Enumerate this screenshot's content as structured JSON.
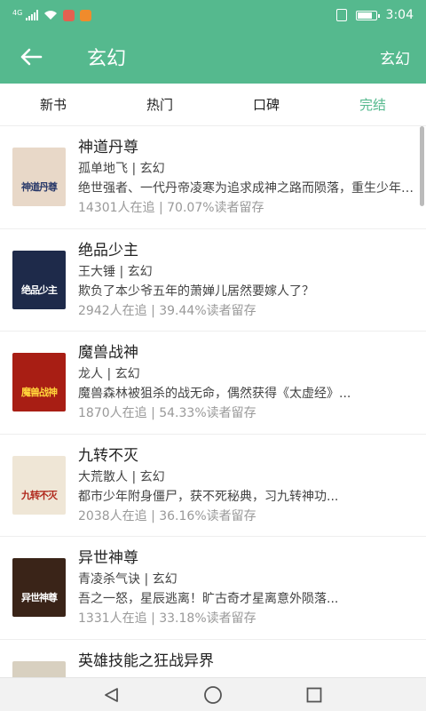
{
  "status": {
    "network": "4G",
    "time": "3:04",
    "colors": {
      "bar": "#55b98e",
      "app_icon_1": "#e36150",
      "app_icon_2": "#f08b2c"
    },
    "icons": [
      "signal-icon",
      "wifi-icon",
      "notification-app-icon",
      "video-app-icon",
      "vibrate-icon",
      "battery-icon"
    ]
  },
  "header": {
    "title": "玄幻",
    "action": "玄幻",
    "back_icon": "arrow-left-icon"
  },
  "tabs": [
    {
      "label": "新书",
      "active": false
    },
    {
      "label": "热门",
      "active": false
    },
    {
      "label": "口碑",
      "active": false
    },
    {
      "label": "完结",
      "active": true
    }
  ],
  "books": [
    {
      "title": "神道丹尊",
      "meta": "孤单地飞 | 玄幻",
      "desc": "绝世强者、一代丹帝凌寒为追求成神之路而陨落，重生少年时代...",
      "stats": "14301人在追 |  70.07%读者留存",
      "cover_text": "神道丹尊",
      "cover_bg": "#e8d8c8",
      "cover_text_color": "#2a3a6a"
    },
    {
      "title": "绝品少主",
      "meta": "王大锤 | 玄幻",
      "desc": "欺负了本少爷五年的萧婵儿居然要嫁人了？",
      "stats": "2942人在追 |  39.44%读者留存",
      "cover_text": "绝品少主",
      "cover_bg": "#1e2a4a",
      "cover_text_color": "#ffffff"
    },
    {
      "title": "魔兽战神",
      "meta": "龙人 | 玄幻",
      "desc": "魔兽森林被狙杀的战无命，偶然获得《太虚经》...",
      "stats": "1870人在追 |  54.33%读者留存",
      "cover_text": "魔兽战神",
      "cover_bg": "#a81e14",
      "cover_text_color": "#ffd23a"
    },
    {
      "title": "九转不灭",
      "meta": "大荒散人 | 玄幻",
      "desc": "都市少年附身僵尸，获不死秘典，习九转神功...",
      "stats": "2038人在追 |  36.16%读者留存",
      "cover_text": "九转不灭",
      "cover_bg": "#efe6d6",
      "cover_text_color": "#b0281c"
    },
    {
      "title": "异世神尊",
      "meta": "青凌杀气诀 | 玄幻",
      "desc": "吾之一怒，星辰逃离！旷古奇才星离意外陨落...",
      "stats": "1331人在追 |  33.18%读者留存",
      "cover_text": "异世神尊",
      "cover_bg": "#3a2418",
      "cover_text_color": "#ffffff"
    },
    {
      "title": "英雄技能之狂战异界",
      "meta": "",
      "desc": "",
      "stats": "",
      "cover_text": "",
      "cover_bg": "#d8d0c0",
      "cover_text_color": "#333333"
    }
  ],
  "nav": {
    "icons": [
      "back-triangle-icon",
      "home-circle-icon",
      "recents-square-icon"
    ]
  }
}
